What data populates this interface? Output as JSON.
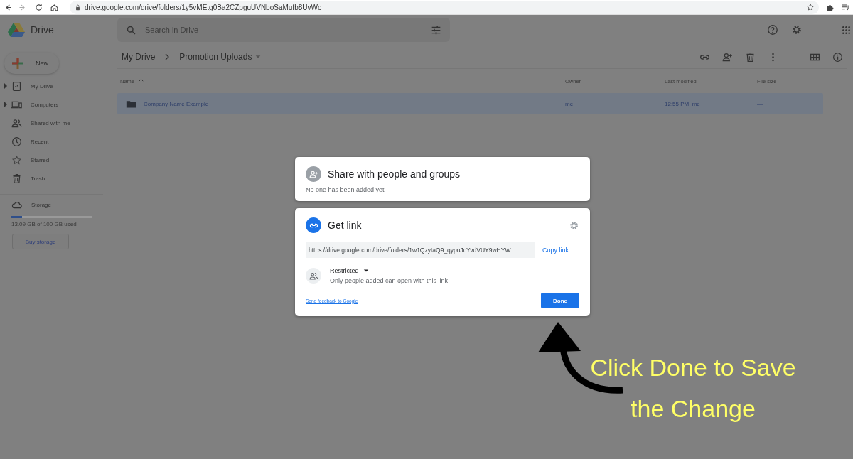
{
  "browser": {
    "url": "drive.google.com/drive/folders/1y5vMEtg0Ba2CZpguUVNboSaMufb8UvWc"
  },
  "app": {
    "name": "Drive",
    "search": {
      "placeholder": "Search in Drive"
    }
  },
  "new_button": "New",
  "sidebar": {
    "items": [
      {
        "label": "My Drive",
        "expandable": true
      },
      {
        "label": "Computers",
        "expandable": true
      },
      {
        "label": "Shared with me",
        "expandable": false
      },
      {
        "label": "Recent",
        "expandable": false
      },
      {
        "label": "Starred",
        "expandable": false
      },
      {
        "label": "Trash",
        "expandable": false
      }
    ]
  },
  "storage": {
    "label": "Storage",
    "level": 0.13,
    "usage": "13.09 GB of 100 GB used",
    "button": "Buy storage"
  },
  "breadcrumb": [
    {
      "label": "My Drive"
    },
    {
      "label": "Promotion Uploads"
    }
  ],
  "table": {
    "columns": [
      "Name",
      "Owner",
      "Last modified",
      "File size"
    ],
    "rows": [
      {
        "name": "Company Name Example",
        "owner": "me",
        "last_modified": "12:55 PM  me",
        "file_size": "—",
        "selected": true
      }
    ]
  },
  "share_dialog": {
    "title": "Share with people and groups",
    "subtitle": "No one has been added yet"
  },
  "link_dialog": {
    "title": "Get link",
    "url": "https://drive.google.com/drive/folders/1w1QzytaQ9_qypuJcYvdVUY9wHYW...",
    "copy": "Copy link",
    "access": "Restricted",
    "access_note": "Only people added can open with this link",
    "feedback": "Send feedback to Google",
    "done": "Done"
  },
  "annotation": {
    "text": "Click Done to Save the Change"
  }
}
